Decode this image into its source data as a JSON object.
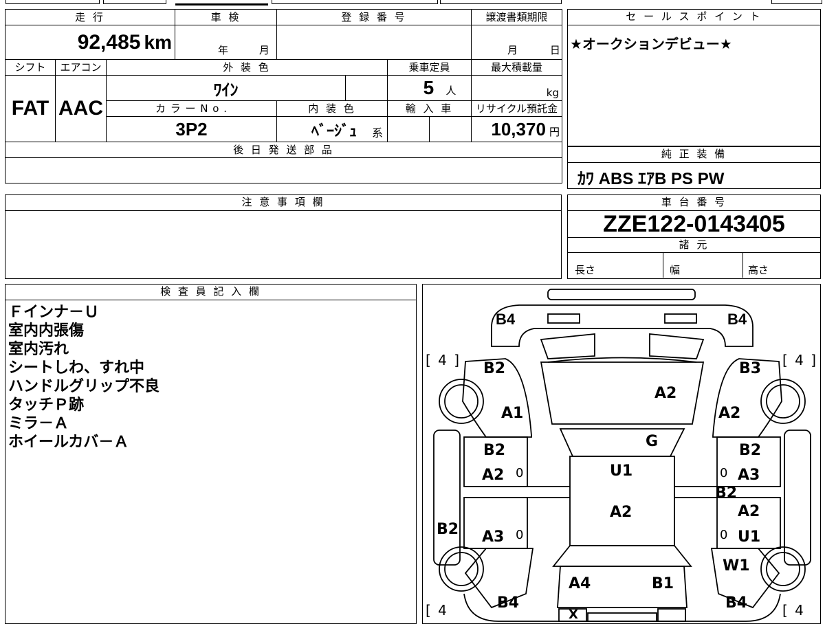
{
  "vehicle": {
    "mileage_label": "走 行",
    "mileage_value": "92,485",
    "mileage_unit": "km",
    "inspection_label": "車 検",
    "inspection_year_unit": "年",
    "inspection_month_unit": "月",
    "registration_label": "登 録 番 号",
    "transfer_deadline_label": "譲渡書類期限",
    "transfer_month_unit": "月",
    "transfer_day_unit": "日",
    "shift_label": "シフト",
    "shift_value": "FAT",
    "aircon_label": "エアコン",
    "aircon_value": "AAC",
    "exterior_color_label": "外 装 色",
    "exterior_color_value": "ﾜｲﾝ",
    "capacity_label": "乗車定員",
    "capacity_value": "5",
    "capacity_unit": "人",
    "max_load_label": "最大積載量",
    "max_load_unit": "kg",
    "color_no_label": "カ ラ ー N o .",
    "color_no_value": "3P2",
    "interior_color_label": "内 装 色",
    "interior_color_value": "ﾍﾞｰｼﾞｭ",
    "interior_color_suffix": "系",
    "import_label": "輸 入 車",
    "recycle_fee_label": "リサイクル預託金",
    "recycle_fee_value": "10,370",
    "recycle_fee_unit": "円",
    "later_parts_label": "後 日 発 送 部 品"
  },
  "sales_point": {
    "label": "セ ー ル ス ポ イ ン ト",
    "text": "★オークションデビュー★"
  },
  "equipment": {
    "label": "純 正 装 備",
    "value": "ｶﾜ ABS ｴｱB PS PW"
  },
  "caution": {
    "label": "注 意 事 項 欄"
  },
  "chassis": {
    "label": "車 台 番 号",
    "value": "ZZE122-0143405",
    "spec_label": "諸 元",
    "length_label": "長さ",
    "width_label": "幅",
    "height_label": "高さ"
  },
  "inspector": {
    "label": "検 査 員 記 入 欄",
    "notes": [
      "Ｆインナ－Ｕ",
      "室内内張傷",
      "室内汚れ",
      "シートしわ、すれ中",
      "ハンドルグリップ不良",
      "タッチＰ跡",
      "ミラ－Ａ",
      "ホイールカバ－Ａ"
    ]
  },
  "diagram": {
    "tire_left_top": "[ 4 ]",
    "tire_right_top": "[ 4 ]",
    "tire_left_bottom": "[ 4",
    "tire_right_bottom": "[ 4",
    "marks": [
      "B4",
      "B4",
      "B2",
      "B3",
      "A2",
      "A1",
      "A2",
      "G",
      "B2",
      "B2",
      "U1",
      "A2",
      "0",
      "0",
      "A3",
      "B2",
      "A2",
      "B2",
      "A3",
      "0",
      "0",
      "U1",
      "W1",
      "A4",
      "B1",
      "B4",
      "B4",
      "X"
    ]
  }
}
